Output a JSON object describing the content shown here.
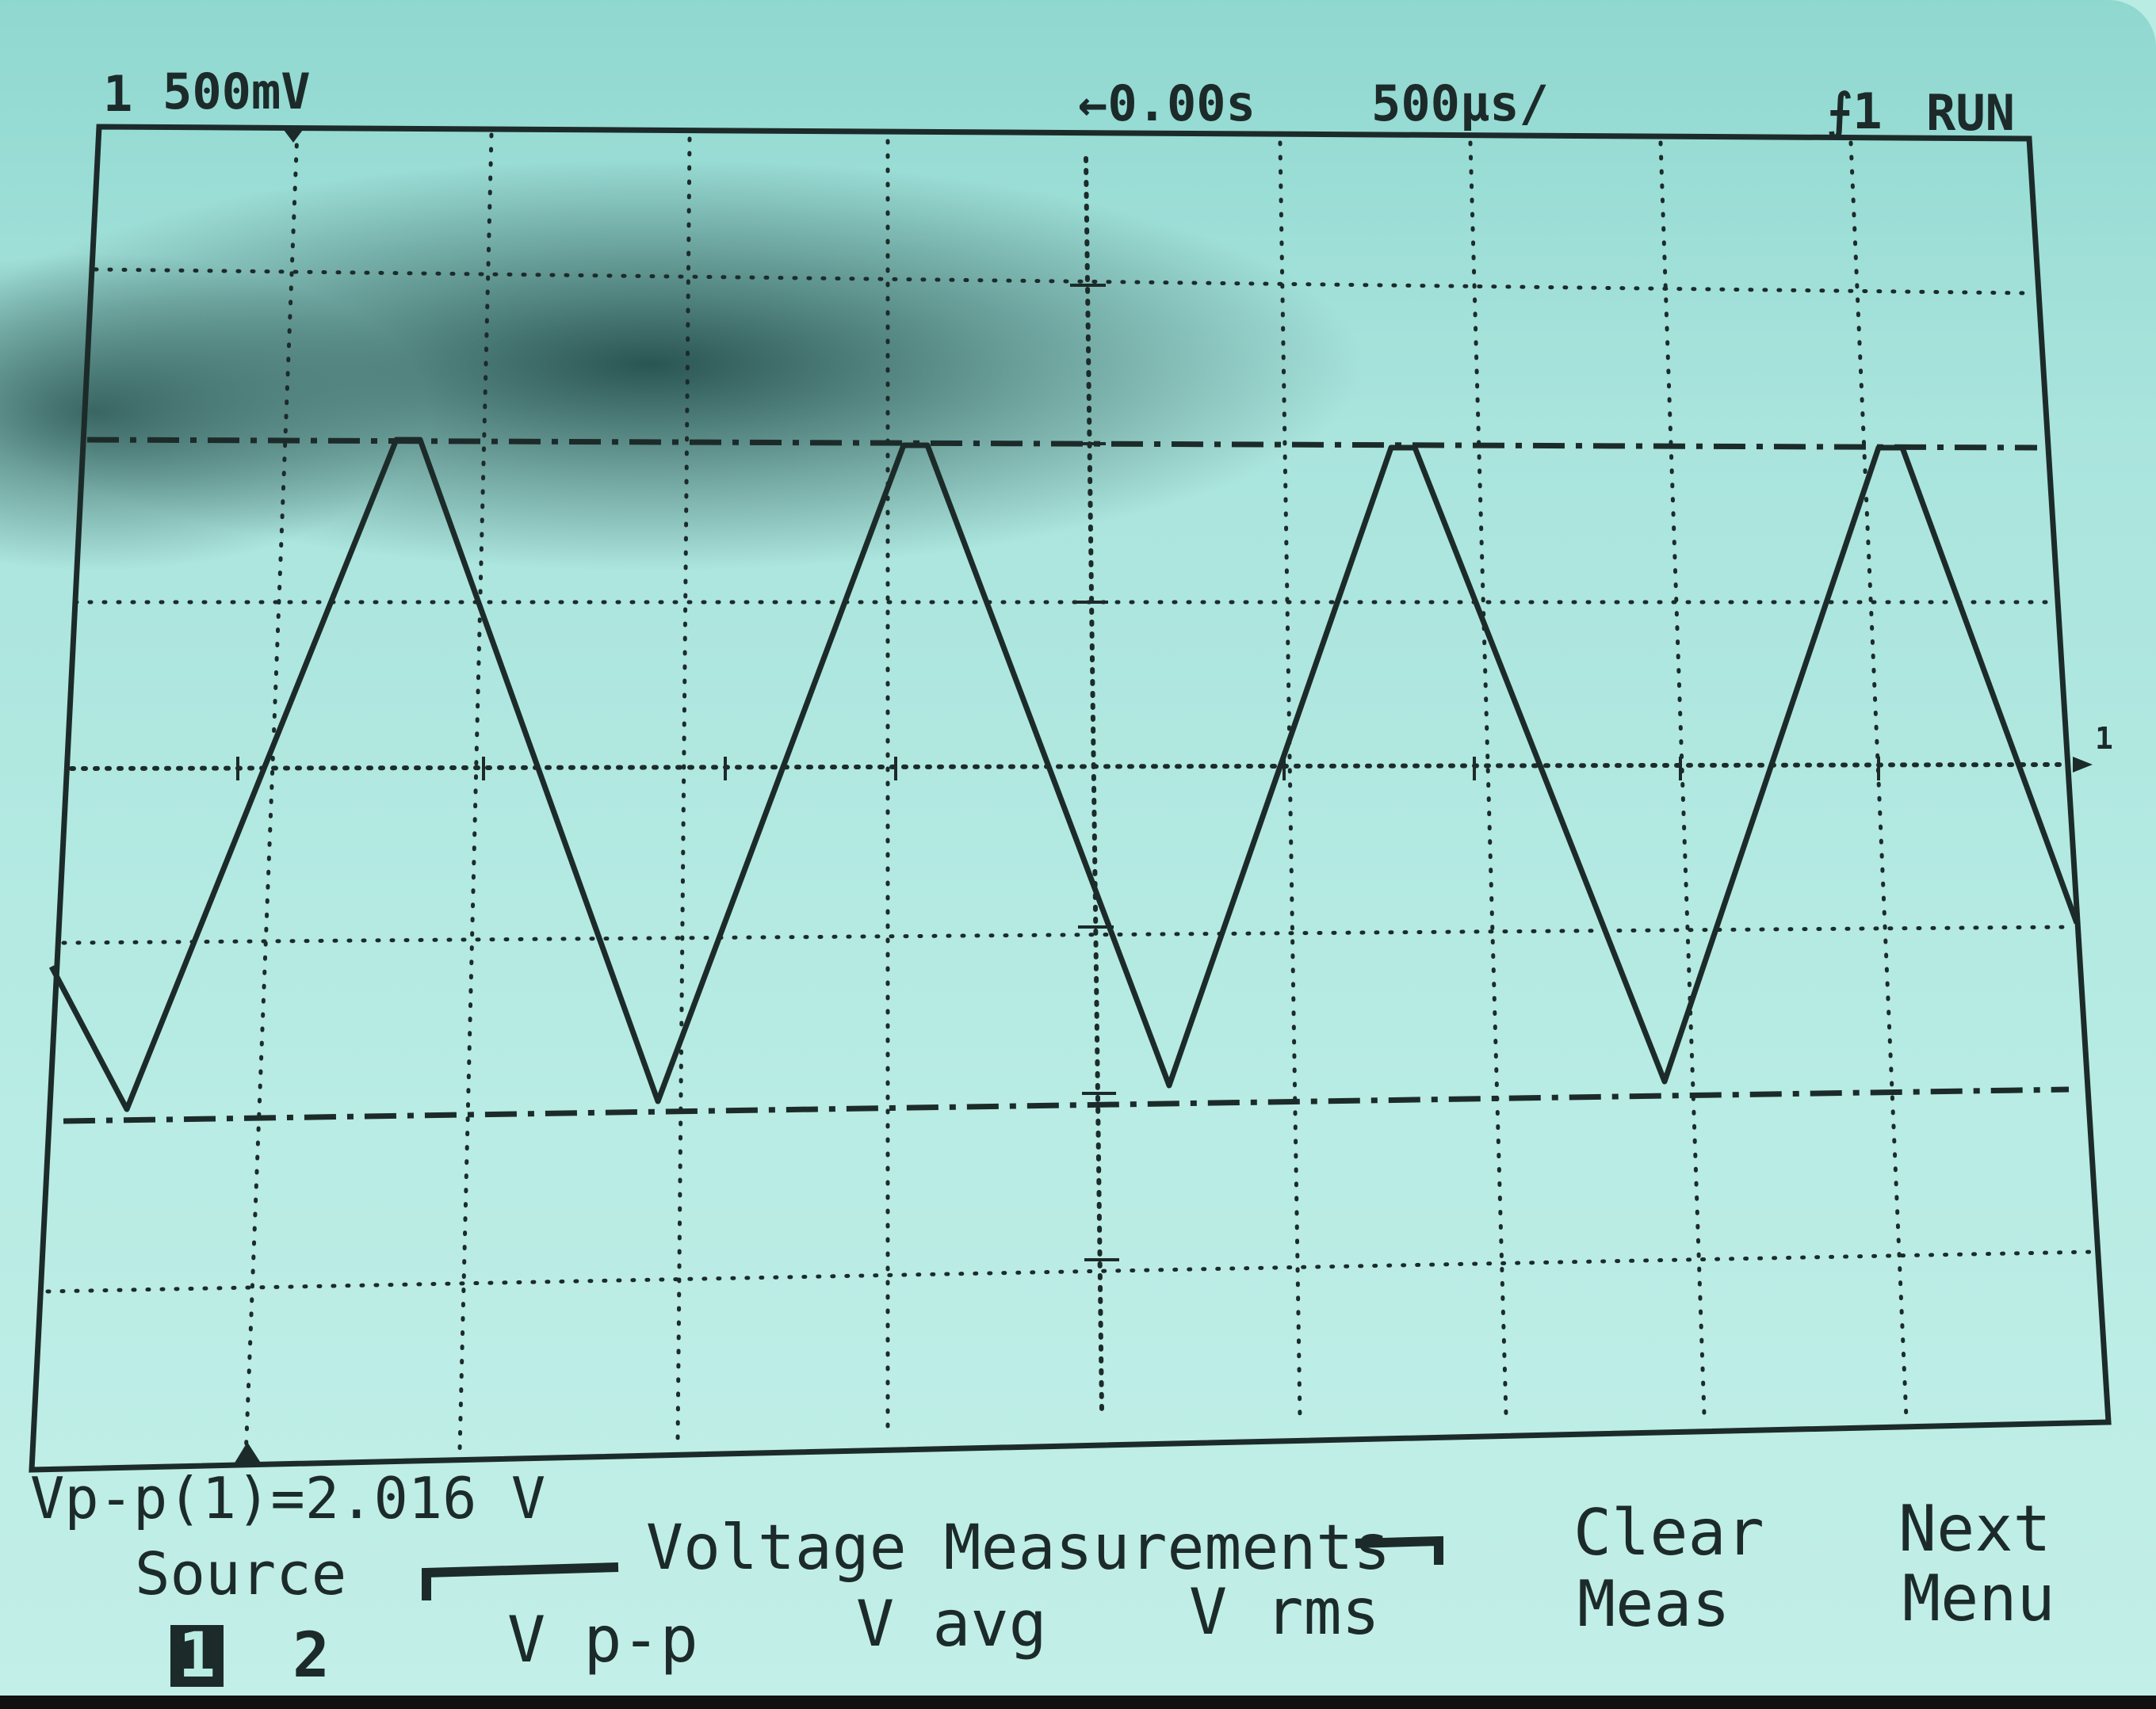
{
  "status_bar": {
    "channel": "1",
    "volts_per_div": "500mV",
    "time_offset": "←0.00s",
    "time_per_div": "500µs/",
    "trigger": "⨍1",
    "run_state": "RUN"
  },
  "measurement_readout": "Vp-p(1)=2.016 V",
  "softkeys": {
    "source": {
      "label": "Source",
      "options": [
        "1",
        "2"
      ],
      "selected": "1"
    },
    "group_title": "Voltage Measurements",
    "vpp": "V p-p",
    "vavg": "V avg",
    "vrms": "V rms",
    "clear_line1": "Clear",
    "clear_line2": "Meas",
    "next_line1": "Next",
    "next_line2": "Menu"
  },
  "ground_marker": "1",
  "waveform": {
    "shape": "triangle",
    "color": "#1c2b2a",
    "cycles_visible": 4,
    "measured_vpp": 2.016,
    "measured_vpp_unit": "V"
  },
  "colors": {
    "screen_background": "#b9ece3",
    "trace": "#1c2b2a",
    "shadow": "#143c3a"
  }
}
